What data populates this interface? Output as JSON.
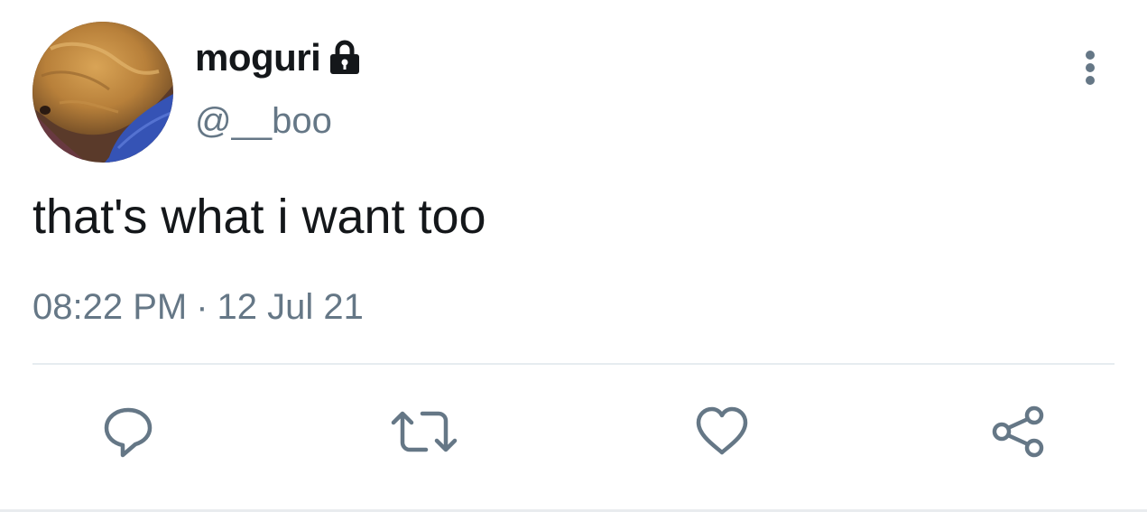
{
  "user": {
    "display_name": "moguri",
    "handle": "@__boo",
    "protected_icon": "lock-icon",
    "avatar_icon": "dog-avatar"
  },
  "tweet": {
    "text": "that's what i want too",
    "time": "08:22 PM",
    "separator": "·",
    "date": "12 Jul 21"
  },
  "actions": [
    {
      "name": "reply",
      "icon": "speech-bubble-icon"
    },
    {
      "name": "retweet",
      "icon": "retweet-icon"
    },
    {
      "name": "like",
      "icon": "heart-icon"
    },
    {
      "name": "share",
      "icon": "share-icon"
    }
  ],
  "colors": {
    "text_primary": "#14171a",
    "text_secondary": "#657786",
    "divider": "#e6ecf0"
  }
}
